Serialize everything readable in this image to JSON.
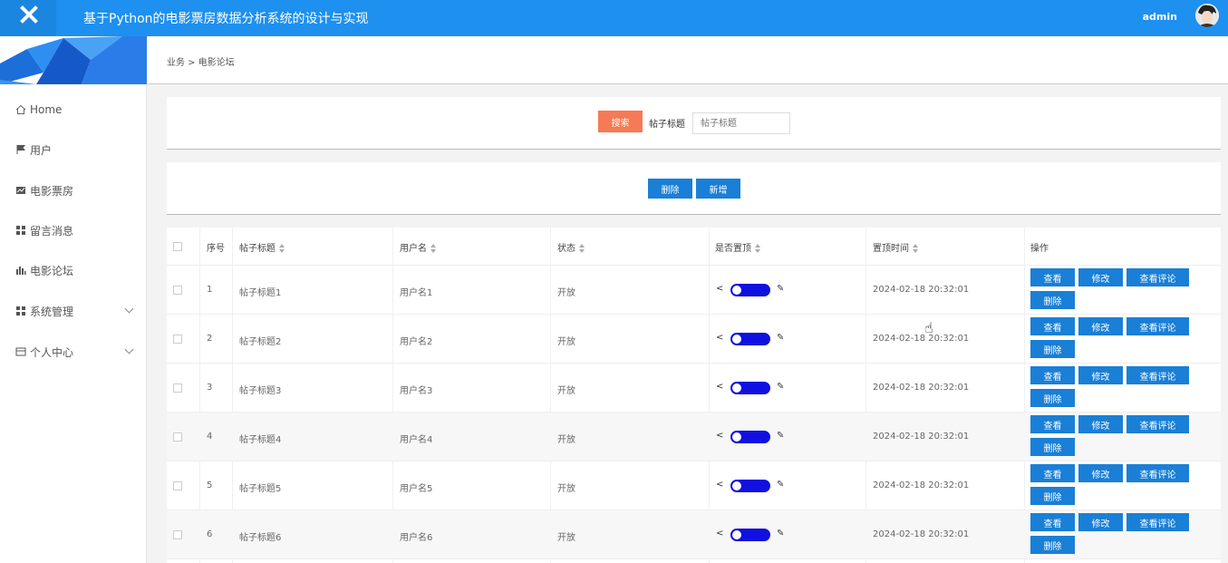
{
  "header": {
    "title": "基于Python的电影票房数据分析系统的设计与实现",
    "user": "admin"
  },
  "sidebar": {
    "items": [
      {
        "label": "Home",
        "icon": "home-icon"
      },
      {
        "label": "用户",
        "icon": "flag-icon"
      },
      {
        "label": "电影票房",
        "icon": "chart-area-icon"
      },
      {
        "label": "留言消息",
        "icon": "grid-icon"
      },
      {
        "label": "电影论坛",
        "icon": "bar-chart-icon"
      },
      {
        "label": "系统管理",
        "icon": "grid-icon"
      },
      {
        "label": "个人中心",
        "icon": "card-icon"
      }
    ]
  },
  "breadcrumb": "业务 > 电影论坛",
  "search": {
    "button": "搜索",
    "label": "帖子标题",
    "placeholder": "帖子标题"
  },
  "actions": {
    "delete": "删除",
    "add": "新增"
  },
  "table": {
    "headers": {
      "index": "序号",
      "title": "帖子标题",
      "username": "用户名",
      "status": "状态",
      "pinned": "是否置顶",
      "pin_time": "置顶时间",
      "ops": "操作"
    },
    "buttons": {
      "view": "查看",
      "edit": "修改",
      "comments": "查看评论",
      "delete": "删除"
    },
    "rows": [
      {
        "index": "1",
        "title": "帖子标题1",
        "username": "用户名1",
        "status": "开放",
        "pin_time": "2024-02-18 20:32:01"
      },
      {
        "index": "2",
        "title": "帖子标题2",
        "username": "用户名2",
        "status": "开放",
        "pin_time": "2024-02-18 20:32:01"
      },
      {
        "index": "3",
        "title": "帖子标题3",
        "username": "用户名3",
        "status": "开放",
        "pin_time": "2024-02-18 20:32:01"
      },
      {
        "index": "4",
        "title": "帖子标题4",
        "username": "用户名4",
        "status": "开放",
        "pin_time": "2024-02-18 20:32:01"
      },
      {
        "index": "5",
        "title": "帖子标题5",
        "username": "用户名5",
        "status": "开放",
        "pin_time": "2024-02-18 20:32:01"
      },
      {
        "index": "6",
        "title": "帖子标题6",
        "username": "用户名6",
        "status": "开放",
        "pin_time": "2024-02-18 20:32:01"
      }
    ]
  },
  "colors": {
    "header": "#1e90f0",
    "primary": "#1a7fd6",
    "search": "#f57a55",
    "toggle": "#1010e0"
  }
}
